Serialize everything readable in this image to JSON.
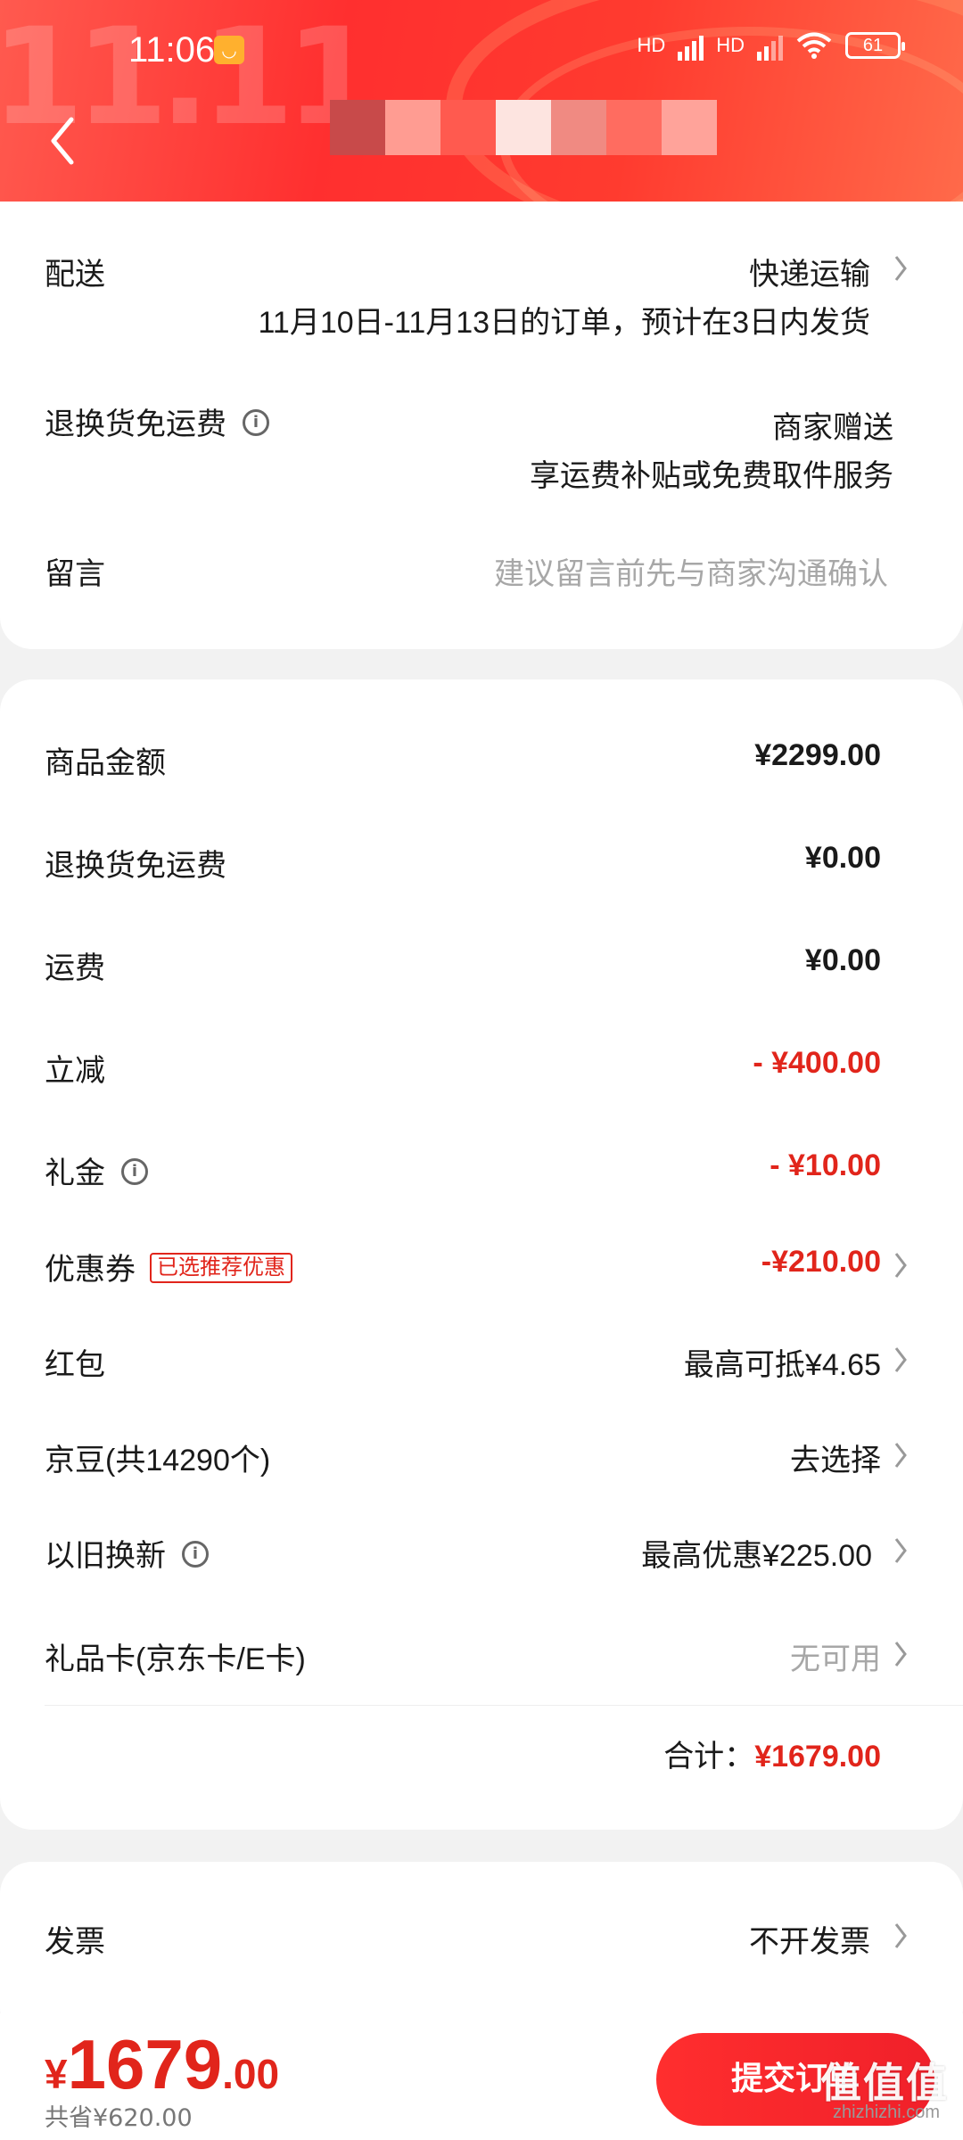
{
  "status": {
    "time": "11:06",
    "net1": "HD",
    "net2": "HD",
    "battery": "61"
  },
  "header": {
    "deco_text": "11.11"
  },
  "delivery": {
    "label": "配送",
    "method": "快递运输",
    "note": "11月10日-11月13日的订单，预计在3日内发货"
  },
  "return_shipping": {
    "label": "退换货免运费",
    "value": "商家赠送",
    "sub": "享运费补贴或免费取件服务"
  },
  "message": {
    "label": "留言",
    "placeholder": "建议留言前先与商家沟通确认"
  },
  "amounts": {
    "goods": {
      "label": "商品金额",
      "value": "¥2299.00"
    },
    "return_fee": {
      "label": "退换货免运费",
      "value": "¥0.00"
    },
    "shipping": {
      "label": "运费",
      "value": "¥0.00"
    },
    "instant_discount": {
      "label": "立减",
      "value": "- ¥400.00"
    },
    "gift_money": {
      "label": "礼金",
      "value": "- ¥10.00"
    },
    "coupon": {
      "label": "优惠券",
      "tag": "已选推荐优惠",
      "value": "-¥210.00"
    },
    "red_packet": {
      "label": "红包",
      "value": "最高可抵¥4.65"
    },
    "jd_beans": {
      "label": "京豆(共14290个)",
      "value": "去选择"
    },
    "trade_in": {
      "label": "以旧换新",
      "value": "最高优惠¥225.00"
    },
    "gift_card": {
      "label": "礼品卡(京东卡/E卡)",
      "value": "无可用"
    },
    "total_label": "合计：",
    "total_value": "¥1679.00"
  },
  "invoice": {
    "label": "发票",
    "value": "不开发票"
  },
  "bottom": {
    "currency": "¥",
    "price_int": "1679",
    "price_dec": ".00",
    "saved": "共省¥620.00",
    "submit": "提交订单"
  },
  "watermark": {
    "main": "值值值",
    "sub": "zhizhizhi.com"
  },
  "colors": {
    "accent": "#e1251b",
    "header": "#ff3b2f"
  }
}
